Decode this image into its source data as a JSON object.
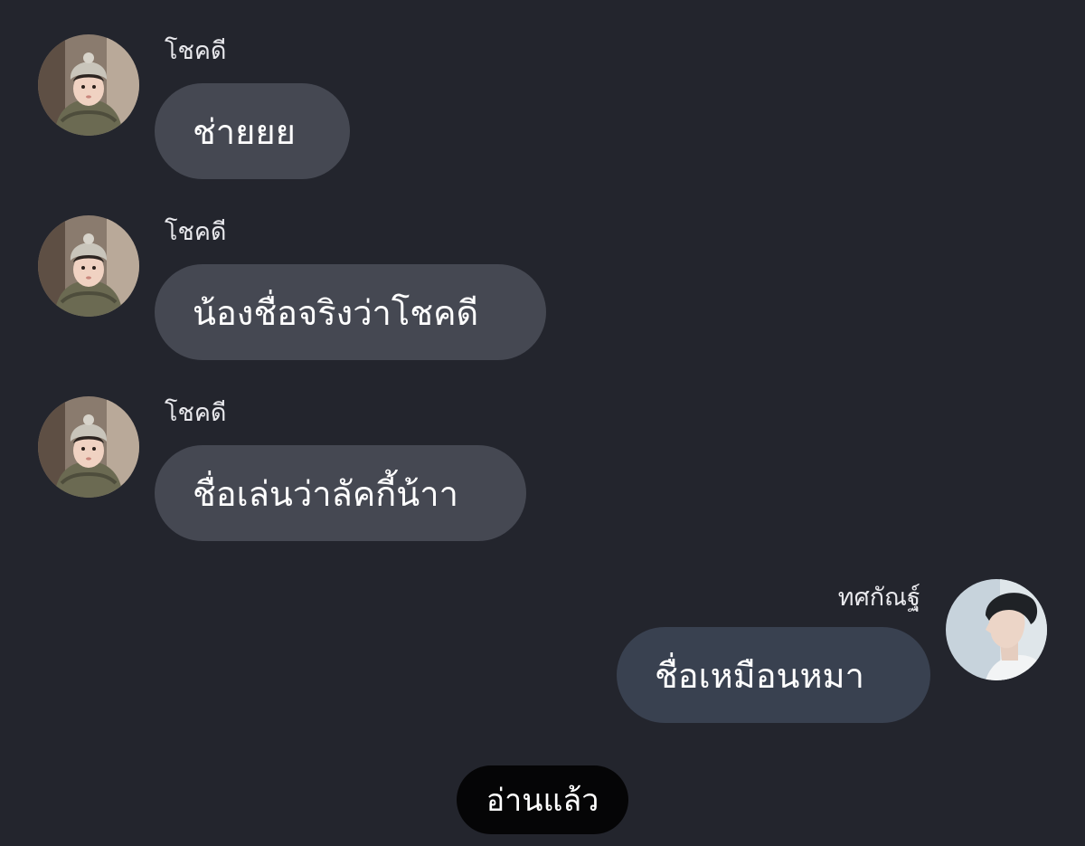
{
  "conversation": {
    "messages": [
      {
        "sender": "โชคดี",
        "text": "ช่ายยย",
        "direction": "incoming",
        "avatar": "child-in-beanie-avatar"
      },
      {
        "sender": "โชคดี",
        "text": "น้องชื่อจริงว่าโชคดี",
        "direction": "incoming",
        "avatar": "child-in-beanie-avatar"
      },
      {
        "sender": "โชคดี",
        "text": "ชื่อเล่นว่าลัคกี้น้าา",
        "direction": "incoming",
        "avatar": "child-in-beanie-avatar"
      },
      {
        "sender": "ทศกัณฐ์",
        "text": "ชื่อเหมือนหมา",
        "direction": "outgoing",
        "avatar": "man-portrait-avatar"
      }
    ],
    "read_status": "อ่านแล้ว"
  },
  "colors": {
    "background": "#23252d",
    "incoming_bubble": "#454852",
    "outgoing_bubble": "#394150",
    "read_badge": "#050506"
  }
}
